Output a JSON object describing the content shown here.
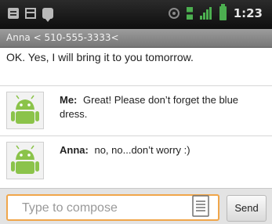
{
  "status_bar": {
    "left_icons": [
      "sms-icon",
      "window-icon",
      "chat-icon"
    ],
    "right_icons": [
      "gps-icon",
      "data-icon",
      "signal-icon",
      "battery-icon"
    ],
    "time": "1:23"
  },
  "title_bar": {
    "title": "Anna < 510-555-3333<"
  },
  "messages": {
    "top_text": "OK. Yes, I will bring it to you tomorrow.",
    "items": [
      {
        "sender": "Me:",
        "text": "Great! Please don’t forget the blue dress.",
        "line1": "Great! Please don’t forget the blue",
        "line2": "dress."
      },
      {
        "sender": "Anna:",
        "text": "no, no...don’t worry :)"
      }
    ]
  },
  "compose": {
    "placeholder": "Type to compose",
    "send_label": "Send"
  },
  "colors": {
    "status_bar_bg": "#111111",
    "title_bar_bg": "#8a8a8a",
    "accent_orange": "#f0a64a",
    "android_green": "#8bc34a"
  }
}
